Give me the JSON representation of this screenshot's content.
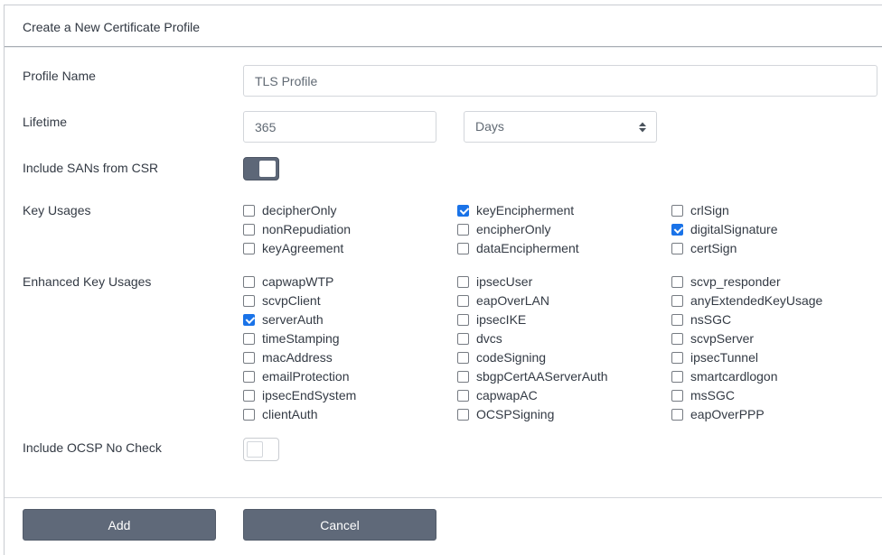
{
  "header": {
    "title": "Create a New Certificate Profile"
  },
  "profile_name": {
    "label": "Profile Name",
    "value": "TLS Profile"
  },
  "lifetime": {
    "label": "Lifetime",
    "value": "365",
    "unit": "Days"
  },
  "include_sans": {
    "label": "Include SANs from CSR",
    "enabled": true
  },
  "key_usages": {
    "label": "Key Usages",
    "items": [
      {
        "label": "decipherOnly",
        "checked": false
      },
      {
        "label": "keyEncipherment",
        "checked": true
      },
      {
        "label": "crlSign",
        "checked": false
      },
      {
        "label": "nonRepudiation",
        "checked": false
      },
      {
        "label": "encipherOnly",
        "checked": false
      },
      {
        "label": "digitalSignature",
        "checked": true
      },
      {
        "label": "keyAgreement",
        "checked": false
      },
      {
        "label": "dataEncipherment",
        "checked": false
      },
      {
        "label": "certSign",
        "checked": false
      }
    ]
  },
  "enhanced_key_usages": {
    "label": "Enhanced Key Usages",
    "items": [
      {
        "label": "capwapWTP",
        "checked": false
      },
      {
        "label": "ipsecUser",
        "checked": false
      },
      {
        "label": "scvp_responder",
        "checked": false
      },
      {
        "label": "scvpClient",
        "checked": false
      },
      {
        "label": "eapOverLAN",
        "checked": false
      },
      {
        "label": "anyExtendedKeyUsage",
        "checked": false
      },
      {
        "label": "serverAuth",
        "checked": true
      },
      {
        "label": "ipsecIKE",
        "checked": false
      },
      {
        "label": "nsSGC",
        "checked": false
      },
      {
        "label": "timeStamping",
        "checked": false
      },
      {
        "label": "dvcs",
        "checked": false
      },
      {
        "label": "scvpServer",
        "checked": false
      },
      {
        "label": "macAddress",
        "checked": false
      },
      {
        "label": "codeSigning",
        "checked": false
      },
      {
        "label": "ipsecTunnel",
        "checked": false
      },
      {
        "label": "emailProtection",
        "checked": false
      },
      {
        "label": "sbgpCertAAServerAuth",
        "checked": false
      },
      {
        "label": "smartcardlogon",
        "checked": false
      },
      {
        "label": "ipsecEndSystem",
        "checked": false
      },
      {
        "label": "capwapAC",
        "checked": false
      },
      {
        "label": "msSGC",
        "checked": false
      },
      {
        "label": "clientAuth",
        "checked": false
      },
      {
        "label": "OCSPSigning",
        "checked": false
      },
      {
        "label": "eapOverPPP",
        "checked": false
      }
    ]
  },
  "ocsp_no_check": {
    "label": "Include OCSP No Check",
    "enabled": false
  },
  "buttons": {
    "add": "Add",
    "cancel": "Cancel"
  },
  "colors": {
    "button": "#5f6979",
    "checkbox_checked": "#1a73e8"
  }
}
